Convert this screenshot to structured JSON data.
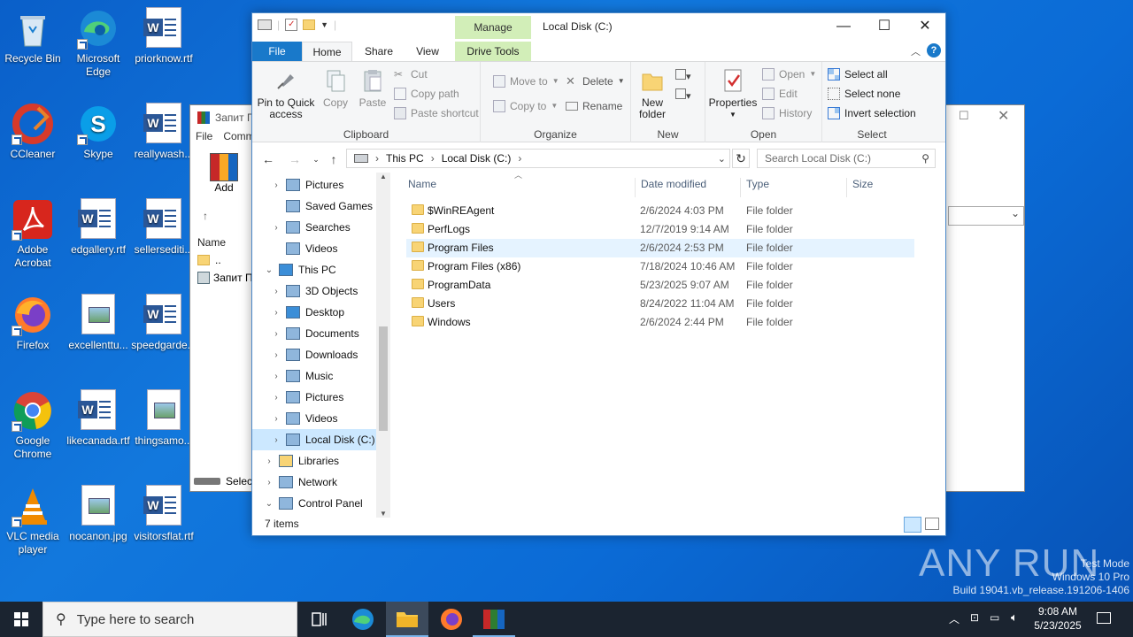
{
  "desktop": {
    "icons": [
      {
        "name": "recycle-bin",
        "label": "Recycle Bin"
      },
      {
        "name": "microsoft-edge",
        "label": "Microsoft Edge"
      },
      {
        "name": "priorknow-rtf",
        "label": "priorknow.rtf"
      },
      {
        "name": "ccleaner",
        "label": "CCleaner"
      },
      {
        "name": "skype",
        "label": "Skype"
      },
      {
        "name": "reallywash",
        "label": "reallywash..."
      },
      {
        "name": "adobe-acrobat",
        "label": "Adobe Acrobat"
      },
      {
        "name": "edgallery-rtf",
        "label": "edgallery.rtf"
      },
      {
        "name": "sellersediti",
        "label": "sellersediti..."
      },
      {
        "name": "firefox",
        "label": "Firefox"
      },
      {
        "name": "excellenttu",
        "label": "excellenttu..."
      },
      {
        "name": "speedgarde",
        "label": "speedgarde..."
      },
      {
        "name": "google-chrome",
        "label": "Google Chrome"
      },
      {
        "name": "likecanada-rtf",
        "label": "likecanada.rtf"
      },
      {
        "name": "thingsamo",
        "label": "thingsamo..."
      },
      {
        "name": "vlc-media-player",
        "label": "VLC media player"
      },
      {
        "name": "nocanon-jpg",
        "label": "nocanon.jpg"
      },
      {
        "name": "visitorsflat-rtf",
        "label": "visitorsflat.rtf"
      }
    ]
  },
  "bg_window": {
    "title": "Запит П",
    "menu": [
      "File",
      "Comm"
    ],
    "add_label": "Add",
    "col_name": "Name",
    "rows": [
      "..",
      "Запит П..."
    ],
    "status": "Selec"
  },
  "explorer": {
    "title": "Local Disk (C:)",
    "manage_label": "Manage",
    "tabs": {
      "file": "File",
      "home": "Home",
      "share": "Share",
      "view": "View",
      "drive_tools": "Drive Tools"
    },
    "ribbon": {
      "clipboard": {
        "group": "Clipboard",
        "pin": "Pin to Quick access",
        "copy": "Copy",
        "paste": "Paste",
        "cut": "Cut",
        "copy_path": "Copy path",
        "paste_shortcut": "Paste shortcut"
      },
      "organize": {
        "group": "Organize",
        "move_to": "Move to",
        "copy_to": "Copy to",
        "delete": "Delete",
        "rename": "Rename"
      },
      "new": {
        "group": "New",
        "new_folder": "New folder"
      },
      "open": {
        "group": "Open",
        "properties": "Properties",
        "open": "Open",
        "edit": "Edit",
        "history": "History"
      },
      "select": {
        "group": "Select",
        "select_all": "Select all",
        "select_none": "Select none",
        "invert": "Invert selection"
      }
    },
    "address": {
      "crumbs": [
        "This PC",
        "Local Disk (C:)"
      ],
      "search_placeholder": "Search Local Disk (C:)"
    },
    "nav": [
      {
        "label": "Pictures",
        "indent": 1,
        "chev": "›"
      },
      {
        "label": "Saved Games",
        "indent": 1,
        "chev": ""
      },
      {
        "label": "Searches",
        "indent": 1,
        "chev": "›"
      },
      {
        "label": "Videos",
        "indent": 1,
        "chev": ""
      },
      {
        "label": "This PC",
        "indent": 0,
        "chev": "⌄"
      },
      {
        "label": "3D Objects",
        "indent": 1,
        "chev": "›"
      },
      {
        "label": "Desktop",
        "indent": 1,
        "chev": "›"
      },
      {
        "label": "Documents",
        "indent": 1,
        "chev": "›"
      },
      {
        "label": "Downloads",
        "indent": 1,
        "chev": "›"
      },
      {
        "label": "Music",
        "indent": 1,
        "chev": "›"
      },
      {
        "label": "Pictures",
        "indent": 1,
        "chev": "›"
      },
      {
        "label": "Videos",
        "indent": 1,
        "chev": "›"
      },
      {
        "label": "Local Disk (C:)",
        "indent": 1,
        "chev": "›"
      },
      {
        "label": "Libraries",
        "indent": 0,
        "chev": "›"
      },
      {
        "label": "Network",
        "indent": 0,
        "chev": "›"
      },
      {
        "label": "Control Panel",
        "indent": 0,
        "chev": "⌄"
      }
    ],
    "columns": {
      "name": "Name",
      "date": "Date modified",
      "type": "Type",
      "size": "Size"
    },
    "files": [
      {
        "name": "$WinREAgent",
        "date": "2/6/2024 4:03 PM",
        "type": "File folder"
      },
      {
        "name": "PerfLogs",
        "date": "12/7/2019 9:14 AM",
        "type": "File folder"
      },
      {
        "name": "Program Files",
        "date": "2/6/2024 2:53 PM",
        "type": "File folder"
      },
      {
        "name": "Program Files (x86)",
        "date": "7/18/2024 10:46 AM",
        "type": "File folder"
      },
      {
        "name": "ProgramData",
        "date": "5/23/2025 9:07 AM",
        "type": "File folder"
      },
      {
        "name": "Users",
        "date": "8/24/2022 11:04 AM",
        "type": "File folder"
      },
      {
        "name": "Windows",
        "date": "2/6/2024 2:44 PM",
        "type": "File folder"
      }
    ],
    "status": "7 items"
  },
  "taskbar": {
    "search_placeholder": "Type here to search",
    "time": "9:08 AM",
    "date": "5/23/2025"
  },
  "watermark": {
    "brand": "ANY RUN",
    "line1": "Test Mode",
    "line2": "Windows 10 Pro",
    "line3": "Build 19041.vb_release.191206-1406"
  }
}
